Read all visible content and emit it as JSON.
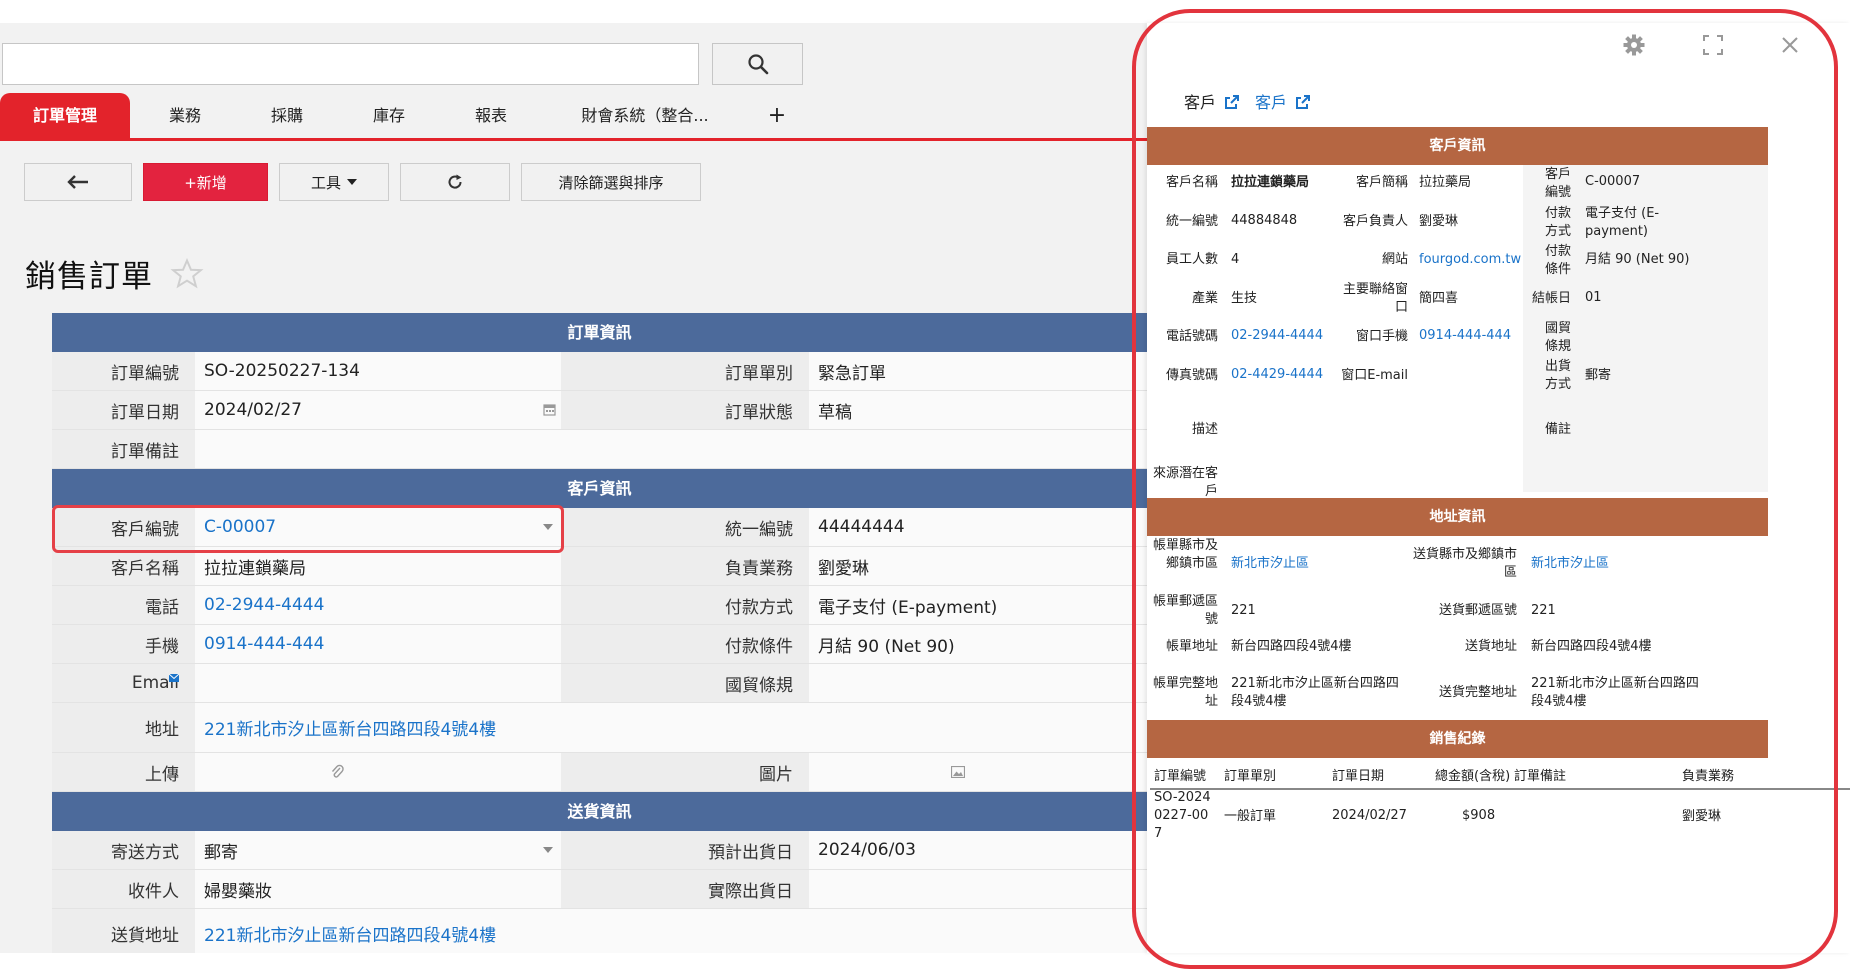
{
  "search": {
    "value": "",
    "placeholder": ""
  },
  "tabs": [
    {
      "label": "訂單管理",
      "active": true
    },
    {
      "label": "業務"
    },
    {
      "label": "採購"
    },
    {
      "label": "庫存"
    },
    {
      "label": "報表"
    },
    {
      "label": "財會系統（整合..."
    }
  ],
  "tab_add_label": "+",
  "toolbar": {
    "new_label": "+新增",
    "tools_label": "工具",
    "clear_label": "清除篩選與排序"
  },
  "page_title": "銷售訂單",
  "form": {
    "order_section": "訂單資訊",
    "order_no_label": "訂單編號",
    "order_no": "SO-20250227-134",
    "order_type_label": "訂單單別",
    "order_type": "緊急訂單",
    "order_date_label": "訂單日期",
    "order_date": "2024/02/27",
    "order_status_label": "訂單狀態",
    "order_status": "草稿",
    "order_note_label": "訂單備註",
    "customer_section": "客戶資訊",
    "cust_no_label": "客戶編號",
    "cust_no": "C-00007",
    "tax_id_label": "統一編號",
    "tax_id": "44444444",
    "cust_name_label": "客戶名稱",
    "cust_name": "拉拉連鎖藥局",
    "sales_label": "負責業務",
    "sales": "劉愛琳",
    "phone_label": "電話",
    "phone": "02-2944-4444",
    "pay_method_label": "付款方式",
    "pay_method": "電子支付 (E-payment)",
    "mobile_label": "手機",
    "mobile": "0914-444-444",
    "pay_terms_label": "付款條件",
    "pay_terms": "月結 90 (Net 90)",
    "email_label": "Email",
    "incoterms_label": "國貿條規",
    "address_label": "地址",
    "address": "221新北市汐止區新台四路四段4號4樓",
    "upload_label": "上傳",
    "image_label": "圖片",
    "shipping_section": "送貨資訊",
    "ship_method_label": "寄送方式",
    "ship_method": "郵寄",
    "est_ship_label": "預計出貨日",
    "est_ship": "2024/06/03",
    "recipient_label": "收件人",
    "recipient": "婦嬰藥妝",
    "actual_ship_label": "實際出貨日",
    "ship_addr_label": "送貨地址",
    "ship_addr": "221新北市汐止區新台四路四段4號4樓"
  },
  "panel": {
    "links": [
      "客戶",
      "客戶"
    ],
    "customer_section": "客戶資訊",
    "c": {
      "name_label": "客戶名稱",
      "name": "拉拉連鎖藥局",
      "short_label": "客戶簡稱",
      "short": "拉拉藥局",
      "no_label": "客戶編號",
      "no": "C-00007",
      "taxid_label": "統一編號",
      "taxid": "44884848",
      "owner_label": "客戶負責人",
      "owner": "劉愛琳",
      "paymethod_label": "付款方式",
      "paymethod": "電子支付 (E-payment)",
      "employees_label": "員工人數",
      "employees": "4",
      "website_label": "網站",
      "website": "fourgod.com.tw",
      "payterms_label": "付款條件",
      "payterms": "月結 90 (Net 90)",
      "industry_label": "產業",
      "industry": "生技",
      "contact_label": "主要聯絡窗口",
      "contact": "簡四喜",
      "closing_label": "結帳日",
      "closing": "01",
      "phone_label": "電話號碼",
      "phone": "02-2944-4444",
      "cmobile_label": "窗口手機",
      "cmobile": "0914-444-444",
      "incoterms_label": "國貿條規",
      "fax_label": "傳真號碼",
      "fax": "02-4429-4444",
      "cemail_label": "窗口E-mail",
      "shipmethod_label": "出貨方式",
      "shipmethod": "郵寄",
      "desc_label": "描述",
      "remark_label": "備註",
      "source_label": "來源潛在客戶"
    },
    "address_section": "地址資訊",
    "a": {
      "bill_city_label": "帳單縣市及鄉鎮市區",
      "bill_city": "新北市汐止區",
      "ship_city_label": "送貨縣市及鄉鎮市區",
      "ship_city": "新北市汐止區",
      "bill_zip_label": "帳單郵遞區號",
      "bill_zip": "221",
      "ship_zip_label": "送貨郵遞區號",
      "ship_zip": "221",
      "bill_addr_label": "帳單地址",
      "bill_addr": "新台四路四段4號4樓",
      "ship_addr_label": "送貨地址",
      "ship_addr": "新台四路四段4號4樓",
      "bill_full_label": "帳單完整地址",
      "bill_full": "221新北市汐止區新台四路四段4號4樓",
      "ship_full_label": "送貨完整地址",
      "ship_full": "221新北市汐止區新台四路四段4號4樓"
    },
    "sales_section": "銷售紀錄",
    "sales_headers": [
      "訂單編號",
      "訂單單別",
      "訂單日期",
      "總金額(含稅)",
      "訂單備註",
      "負責業務"
    ],
    "sales_rows": [
      {
        "order_no": "SO-20240227-007",
        "type": "一般訂單",
        "date": "2024/02/27",
        "total": "$908",
        "note": "",
        "sales": "劉愛琳"
      }
    ]
  }
}
